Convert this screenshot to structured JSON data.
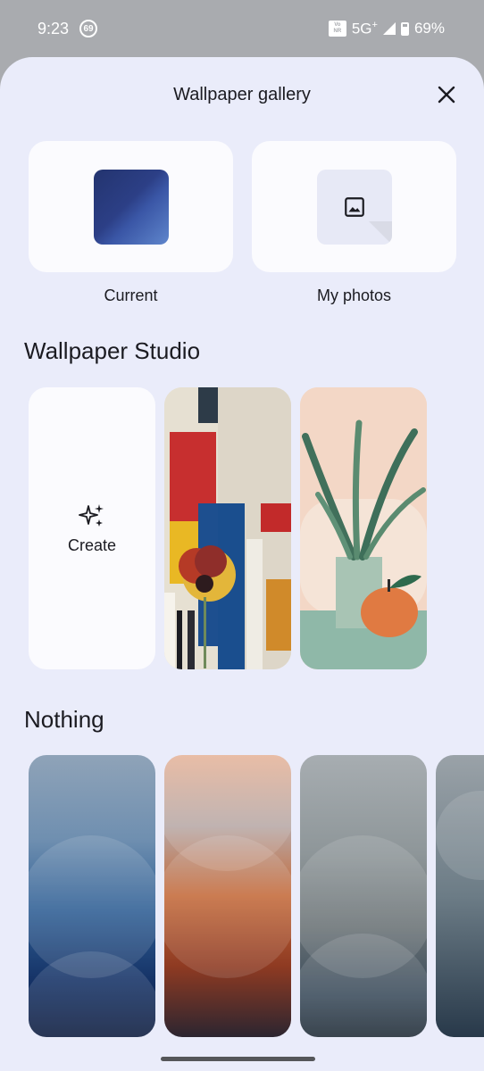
{
  "status_bar": {
    "time": "9:23",
    "notification_count": "69",
    "network": "5G",
    "network_plus": "+",
    "volte_top": "Vo",
    "volte_bottom": "NR",
    "battery": "69%"
  },
  "sheet": {
    "title": "Wallpaper gallery",
    "top_cards": [
      {
        "label": "Current"
      },
      {
        "label": "My photos"
      }
    ]
  },
  "sections": {
    "studio": {
      "title": "Wallpaper Studio",
      "create_label": "Create"
    },
    "nothing": {
      "title": "Nothing"
    }
  },
  "colors": {
    "sheet_bg": "#eaecfa",
    "card_bg": "#fbfbfe",
    "status_bg": "#a9abaf"
  }
}
